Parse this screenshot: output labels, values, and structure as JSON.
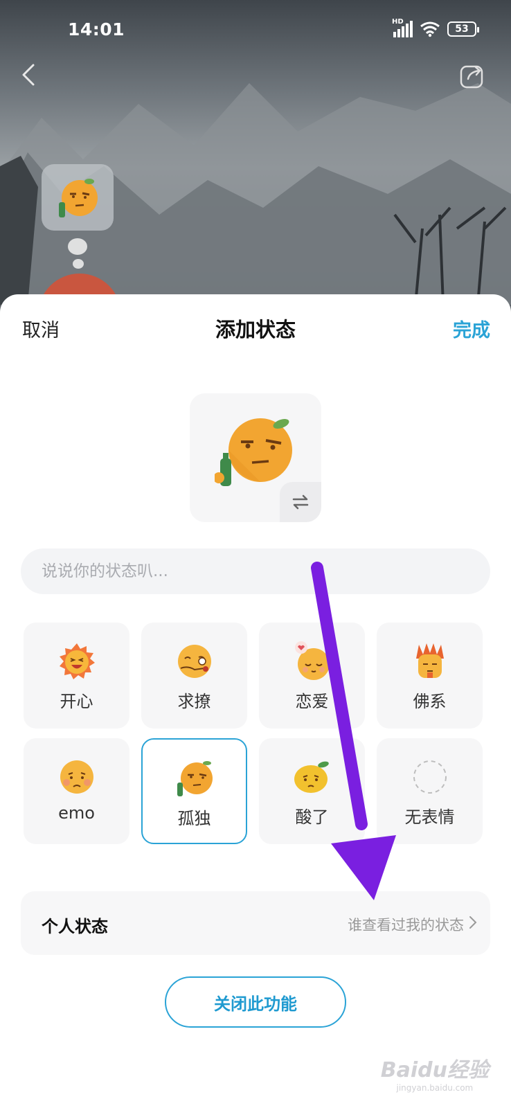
{
  "status_bar": {
    "time": "14:01",
    "network": "HD",
    "battery": "53"
  },
  "top_nav": {
    "back_icon": "chevron-left-icon",
    "share_icon": "share-icon"
  },
  "sheet": {
    "cancel_label": "取消",
    "title": "添加状态",
    "done_label": "完成",
    "input_placeholder": "说说你的状态叭...",
    "swap_icon": "swap-icon",
    "moods": [
      {
        "label": "开心",
        "icon": "happy-sun-icon",
        "selected": false
      },
      {
        "label": "求撩",
        "icon": "flirty-face-icon",
        "selected": false
      },
      {
        "label": "恋爱",
        "icon": "in-love-face-icon",
        "selected": false
      },
      {
        "label": "佛系",
        "icon": "zen-face-icon",
        "selected": false
      },
      {
        "label": "emo",
        "icon": "sad-face-icon",
        "selected": false
      },
      {
        "label": "孤独",
        "icon": "lonely-orange-icon",
        "selected": true
      },
      {
        "label": "酸了",
        "icon": "sour-lemon-icon",
        "selected": false
      },
      {
        "label": "无表情",
        "icon": "empty-circle-icon",
        "selected": false
      }
    ],
    "personal_status": {
      "title": "个人状态",
      "link": "谁查看过我的状态"
    },
    "close_feature_label": "关闭此功能"
  },
  "colors": {
    "accent": "#2aa3d6",
    "annotation_arrow": "#7a1fe0"
  },
  "watermark": {
    "brand": "Baidu经验",
    "url": "jingyan.baidu.com"
  }
}
